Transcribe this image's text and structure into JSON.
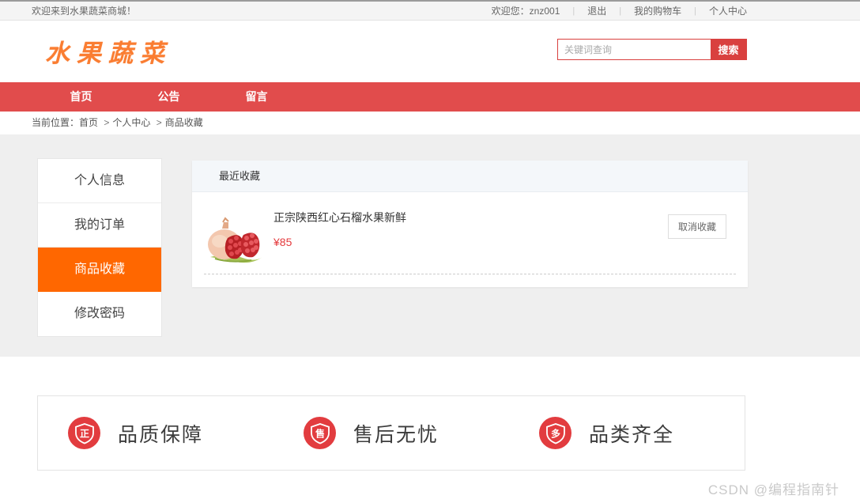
{
  "topbar": {
    "welcome": "欢迎来到水果蔬菜商城！",
    "user_greeting": "欢迎您：znz001",
    "pipe": "|",
    "links": [
      {
        "label": "退出"
      },
      {
        "label": "我的购物车"
      },
      {
        "label": "个人中心"
      }
    ]
  },
  "header": {
    "logo": "水果蔬菜",
    "search": {
      "placeholder": "关键词查询",
      "button": "搜索"
    }
  },
  "nav": {
    "items": [
      {
        "label": "首页"
      },
      {
        "label": "公告"
      },
      {
        "label": "留言"
      }
    ]
  },
  "breadcrumb": {
    "label": "当前位置：",
    "separator": ">",
    "items": [
      {
        "label": "首页"
      },
      {
        "label": "个人中心"
      },
      {
        "label": "商品收藏"
      }
    ]
  },
  "sidebar": {
    "items": [
      {
        "label": "个人信息",
        "active": false
      },
      {
        "label": "我的订单",
        "active": false
      },
      {
        "label": "商品收藏",
        "active": true
      },
      {
        "label": "修改密码",
        "active": false
      }
    ]
  },
  "panel": {
    "title": "最近收藏",
    "product": {
      "name": "正宗陕西红心石榴水果新鲜",
      "price": "¥85",
      "cancel_button": "取消收藏",
      "image": "pomegranate-photo"
    }
  },
  "features": {
    "items": [
      {
        "icon_char": "正",
        "icon": "shield-quality-icon",
        "label": "品质保障"
      },
      {
        "icon_char": "售",
        "icon": "shield-aftersale-icon",
        "label": "售后无忧"
      },
      {
        "icon_char": "多",
        "icon": "shield-variety-icon",
        "label": "品类齐全"
      }
    ]
  },
  "watermark": "CSDN @编程指南针",
  "colors": {
    "nav_red": "#e14c4c",
    "search_red": "#d9403f",
    "active_orange": "#ff6700",
    "price_red": "#e4393c",
    "feature_icon_red": "#e23c3f"
  }
}
